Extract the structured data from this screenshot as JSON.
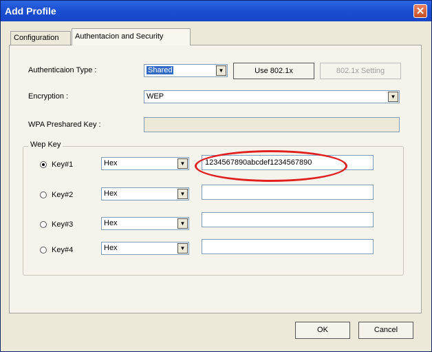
{
  "window": {
    "title": "Add Profile",
    "close_glyph": "✕"
  },
  "tabs": [
    {
      "label": "Configuration"
    },
    {
      "label": "Authentacion and Security"
    }
  ],
  "auth": {
    "type_label": "Authenticaion Type :",
    "type_value": "Shared",
    "use8021x_label": "Use 802.1x",
    "setting8021x_label": "802.1x Setting"
  },
  "encryption": {
    "label": "Encryption :",
    "value": "WEP"
  },
  "wpa": {
    "label": "WPA Preshared Key :",
    "value": ""
  },
  "wep": {
    "group_label": "Wep Key",
    "keys": [
      {
        "label": "Key#1",
        "format": "Hex",
        "value": "1234567890abcdef1234567890",
        "selected": true
      },
      {
        "label": "Key#2",
        "format": "Hex",
        "value": "",
        "selected": false
      },
      {
        "label": "Key#3",
        "format": "Hex",
        "value": "",
        "selected": false
      },
      {
        "label": "Key#4",
        "format": "Hex",
        "value": "",
        "selected": false
      }
    ]
  },
  "footer": {
    "ok_label": "OK",
    "cancel_label": "Cancel"
  },
  "icons": {
    "dropdown": "dropdown-arrow-icon",
    "close": "close-icon"
  },
  "colors": {
    "titlebar": "#1a4fd0",
    "highlight": "#316ac5",
    "annotation": "#e02020"
  }
}
